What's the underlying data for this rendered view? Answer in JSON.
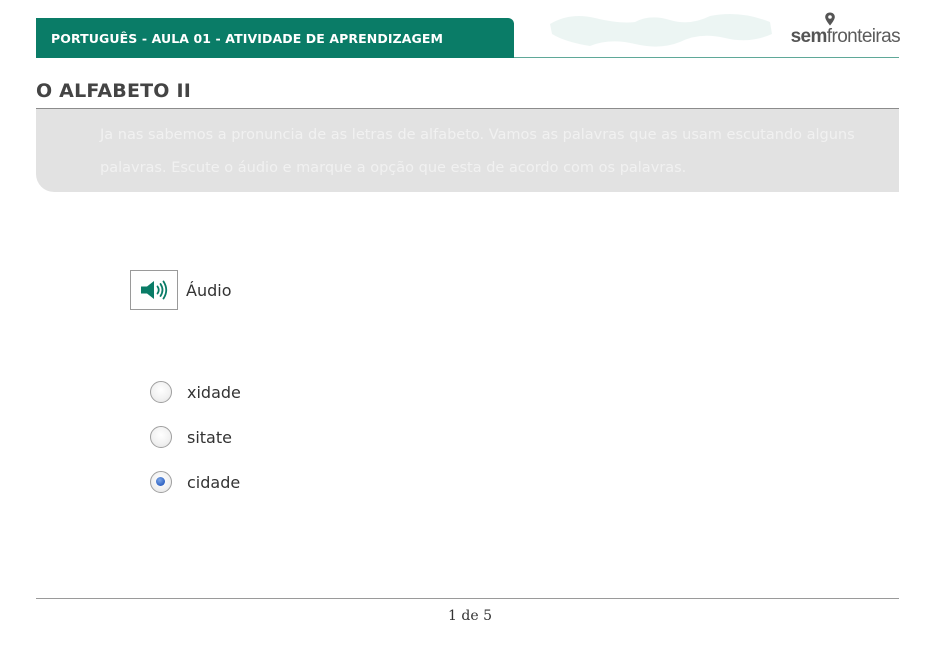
{
  "header": {
    "title": "PORTUGUÊS - AULA 01 - ATIVIDADE DE APRENDIZAGEM",
    "logo_sem": "sem",
    "logo_fronteiras": "fronteiras"
  },
  "section": {
    "title": "O ALFABETO II",
    "instruction": "Ja nas sabemos a pronuncia de as letras de alfabeto. Vamos as palavras que as usam escutando alguns palavras. Escute o áudio e marque a opção que esta de acordo com os palavras."
  },
  "audio": {
    "label": "Áudio",
    "icon": "speaker-icon"
  },
  "options": [
    {
      "label": "xidade",
      "selected": false
    },
    {
      "label": "sitate",
      "selected": false
    },
    {
      "label": "cidade",
      "selected": true
    }
  ],
  "footer": {
    "pagination": "1 de 5"
  },
  "colors": {
    "brand": "#0a7c67",
    "radio_selected": "#2f63c4"
  }
}
